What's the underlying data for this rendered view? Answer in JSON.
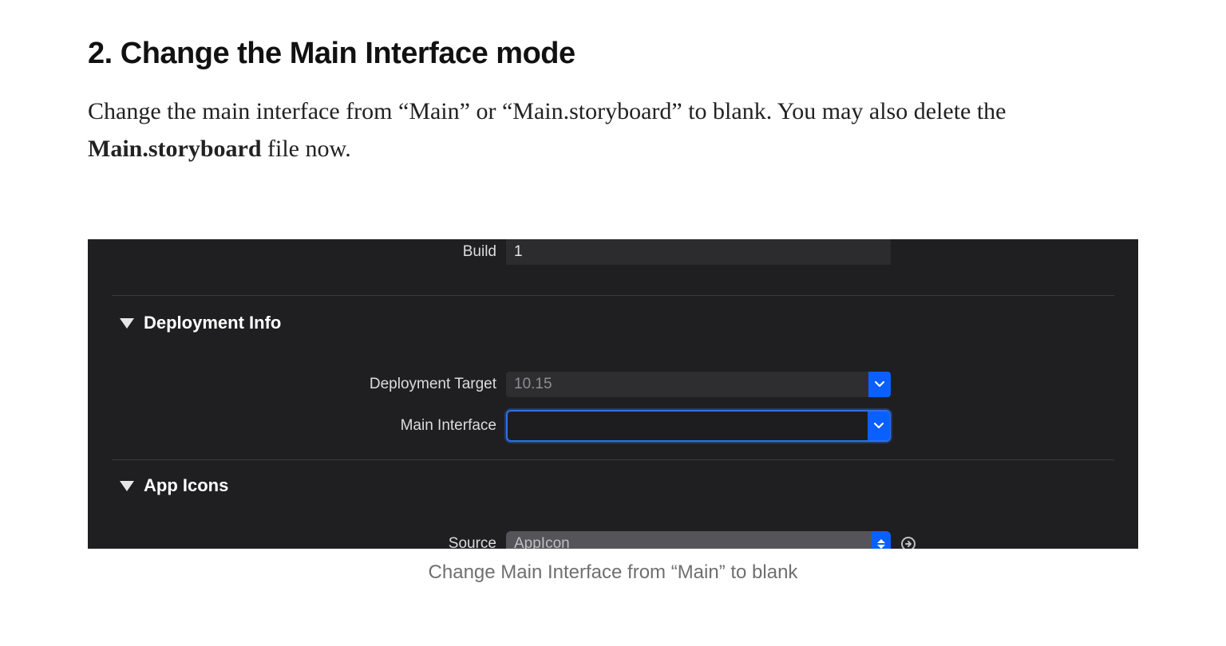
{
  "article": {
    "heading": "2. Change the Main Interface mode",
    "body_plain_prefix": "Change the main interface from “Main” or “Main.storyboard” to blank. You may also delete the ",
    "body_bold": "Main.storyboard",
    "body_plain_suffix": " file now."
  },
  "screenshot": {
    "build": {
      "label": "Build",
      "value": "1"
    },
    "sections": {
      "deployment_info": "Deployment Info",
      "app_icons": "App Icons"
    },
    "deployment_target": {
      "label": "Deployment Target",
      "value": "10.15"
    },
    "main_interface": {
      "label": "Main Interface",
      "value": ""
    },
    "source": {
      "label": "Source",
      "value": "AppIcon"
    }
  },
  "caption": "Change Main Interface from “Main” to blank"
}
